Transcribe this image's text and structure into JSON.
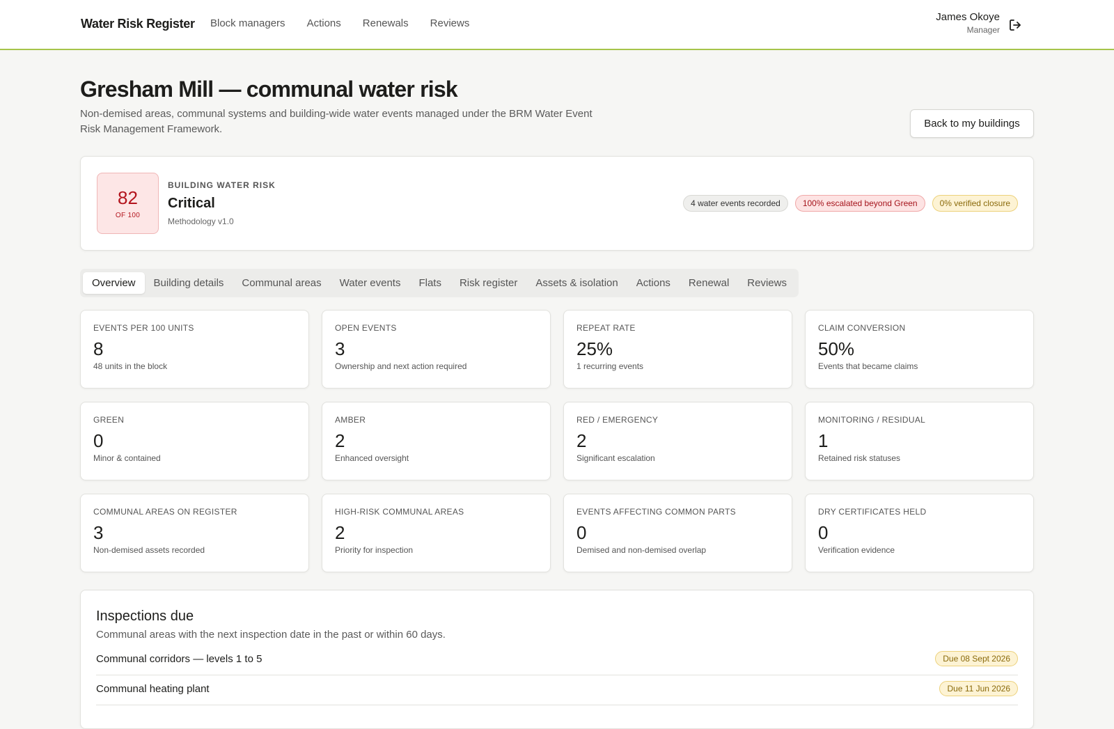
{
  "header": {
    "brand": "Water Risk Register",
    "nav": [
      "Block managers",
      "Actions",
      "Renewals",
      "Reviews"
    ],
    "user_name": "James Okoye",
    "user_role": "Manager",
    "logout_icon": "logout-icon"
  },
  "page": {
    "title": "Gresham Mill — communal water risk",
    "subtitle": "Non-demised areas, communal systems and building-wide water events managed under the BRM Water Event Risk Management Framework.",
    "back_button": "Back to my buildings"
  },
  "risk": {
    "score": "82",
    "score_of": "OF 100",
    "label": "BUILDING WATER RISK",
    "level": "Critical",
    "methodology": "Methodology v1.0",
    "pills": {
      "events": "4 water events recorded",
      "escalated": "100% escalated beyond Green",
      "closure": "0% verified closure"
    }
  },
  "tabs": [
    "Overview",
    "Building details",
    "Communal areas",
    "Water events",
    "Flats",
    "Risk register",
    "Assets & isolation",
    "Actions",
    "Renewal",
    "Reviews"
  ],
  "metrics": [
    {
      "label": "Events per 100 units",
      "value": "8",
      "note": "48 units in the block"
    },
    {
      "label": "Open events",
      "value": "3",
      "note": "Ownership and next action required"
    },
    {
      "label": "Repeat rate",
      "value": "25%",
      "note": "1 recurring events"
    },
    {
      "label": "Claim conversion",
      "value": "50%",
      "note": "Events that became claims"
    },
    {
      "label": "Green",
      "value": "0",
      "note": "Minor & contained"
    },
    {
      "label": "Amber",
      "value": "2",
      "note": "Enhanced oversight"
    },
    {
      "label": "Red / emergency",
      "value": "2",
      "note": "Significant escalation"
    },
    {
      "label": "Monitoring / residual",
      "value": "1",
      "note": "Retained risk statuses"
    },
    {
      "label": "Communal areas on register",
      "value": "3",
      "note": "Non-demised assets recorded"
    },
    {
      "label": "High-risk communal areas",
      "value": "2",
      "note": "Priority for inspection"
    },
    {
      "label": "Events affecting common parts",
      "value": "0",
      "note": "Demised and non-demised overlap"
    },
    {
      "label": "Dry certificates held",
      "value": "0",
      "note": "Verification evidence"
    }
  ],
  "inspections": {
    "title": "Inspections due",
    "subtitle": "Communal areas with the next inspection date in the past or within 60 days.",
    "rows": [
      {
        "name": "Communal corridors — levels 1 to 5",
        "due": "Due 08 Sept 2026"
      },
      {
        "name": "Communal heating plant",
        "due": "Due 11 Jun 2026"
      }
    ]
  },
  "colors": {
    "accent_line": "#a6c44a",
    "critical_red": "#b3141d",
    "amber": "#8a6a0b"
  }
}
